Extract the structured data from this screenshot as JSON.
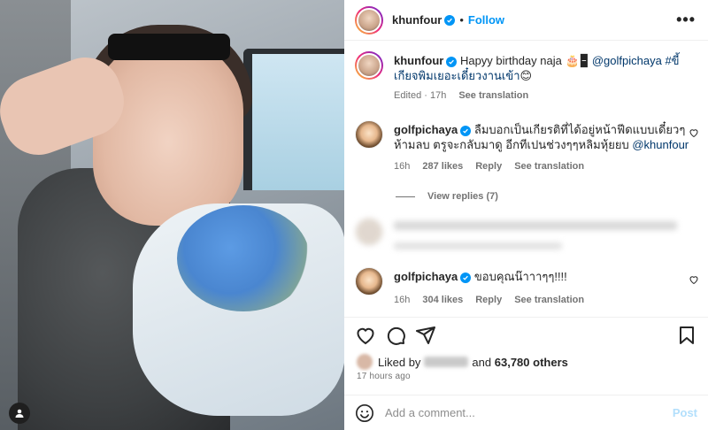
{
  "post": {
    "author": "khunfour",
    "follow_label": "Follow",
    "more_label": "•••"
  },
  "caption": {
    "username": "khunfour",
    "text_before": "Hapyy birthday naja 🎂🁢 ",
    "mention": "@golfpichaya",
    "hashtag": " #ขี้เกียจพิมเยอะเดี๋ยวงานเข้า",
    "emoji_after": "😊",
    "edited_time": "Edited · 17h",
    "see_translation": "See translation"
  },
  "comments": [
    {
      "username": "golfpichaya",
      "text": "ลืมบอกเป็นเกียรติที่ได้อยู่หน้าฟีดแบบเดี๋ยวๆ ห้ามลบ ตรูจะกลับมาดู อีกทีเปนช่วงๆๆหลิมหุ้ยยบ ",
      "mention": "@khunfour",
      "time": "16h",
      "likes": "287 likes",
      "reply": "Reply",
      "see_translation": "See translation",
      "view_replies": "View replies (7)"
    },
    {
      "username": "golfpichaya",
      "text": "ขอบคุณน๊าาาๆๆ!!!!",
      "mention": "",
      "time": "16h",
      "likes": "304 likes",
      "reply": "Reply",
      "see_translation": "See translation"
    }
  ],
  "liked_by": {
    "prefix": "Liked by",
    "conjunction": "and",
    "others": "63,780 others"
  },
  "timestamp": "17 hours ago",
  "comment_box": {
    "placeholder": "Add a comment...",
    "post_label": "Post"
  },
  "colors": {
    "link_blue": "#0095f6",
    "mention_blue": "#00376b",
    "post_disabled": "#b2dffc"
  }
}
